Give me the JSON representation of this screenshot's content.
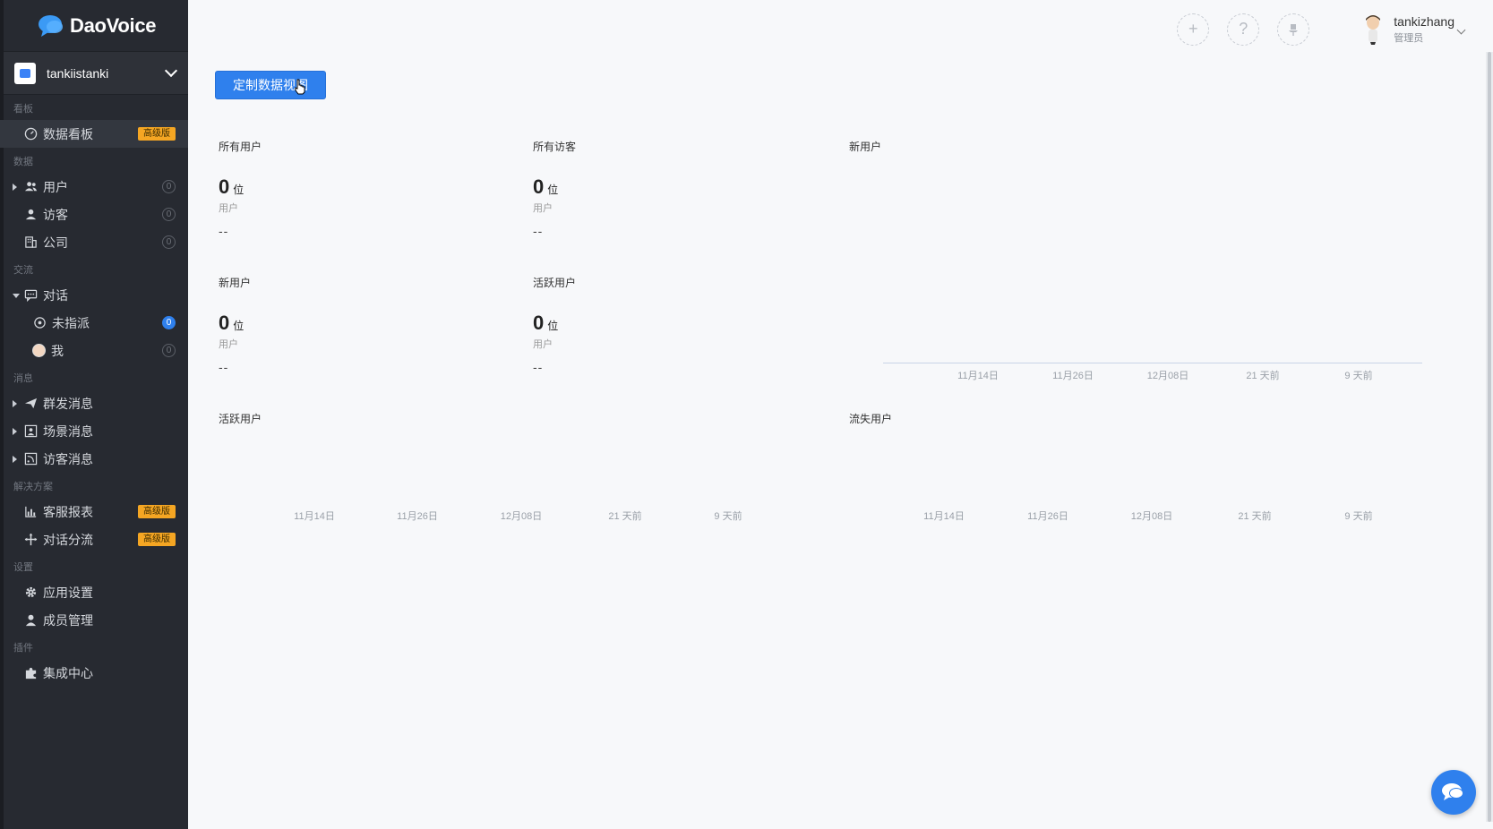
{
  "app": {
    "name": "DaoVoice"
  },
  "team": {
    "name": "tankiistanki"
  },
  "sidebar": {
    "sections": {
      "board": "看板",
      "data": "数据",
      "comm": "交流",
      "msg": "消息",
      "solutions": "解决方案",
      "settings": "设置",
      "plugins": "插件"
    },
    "items": {
      "dashboard": "数据看板",
      "users": "用户",
      "visitors": "访客",
      "companies": "公司",
      "conversations": "对话",
      "unassigned": "未指派",
      "me": "我",
      "mass_msg": "群发消息",
      "scene_msg": "场景消息",
      "visitor_msg": "访客消息",
      "reports": "客服报表",
      "routing": "对话分流",
      "app_settings": "应用设置",
      "members": "成员管理",
      "integrations": "集成中心"
    },
    "pro_badge": "高级版",
    "counts": {
      "users": "0",
      "visitors": "0",
      "companies": "0",
      "unassigned": "0",
      "me": "0"
    }
  },
  "header": {
    "user_name": "tankizhang",
    "user_role": "管理员",
    "add_icon": "+",
    "help_icon": "?"
  },
  "main": {
    "customize_button": "定制数据视图",
    "stats": {
      "all_users": {
        "title": "所有用户",
        "value": "0",
        "unit": "位",
        "sub": "用户",
        "delta": "--"
      },
      "all_visitors": {
        "title": "所有访客",
        "value": "0",
        "unit": "位",
        "sub": "用户",
        "delta": "--"
      },
      "new_users": {
        "title": "新用户",
        "value": "0",
        "unit": "位",
        "sub": "用户",
        "delta": "--"
      },
      "active_users": {
        "title": "活跃用户",
        "value": "0",
        "unit": "位",
        "sub": "用户",
        "delta": "--"
      }
    },
    "charts": {
      "new_users": {
        "title": "新用户",
        "ticks": [
          "11月14日",
          "11月26日",
          "12月08日",
          "21 天前",
          "9 天前"
        ]
      },
      "active_users": {
        "title": "活跃用户",
        "ticks": [
          "11月14日",
          "11月26日",
          "12月08日",
          "21 天前",
          "9 天前"
        ]
      },
      "churned_users": {
        "title": "流失用户",
        "ticks": [
          "11月14日",
          "11月26日",
          "12月08日",
          "21 天前",
          "9 天前"
        ]
      }
    }
  },
  "colors": {
    "accent": "#2f80ed",
    "sidebar_bg": "#272a31",
    "pro_badge": "#f5a623"
  }
}
